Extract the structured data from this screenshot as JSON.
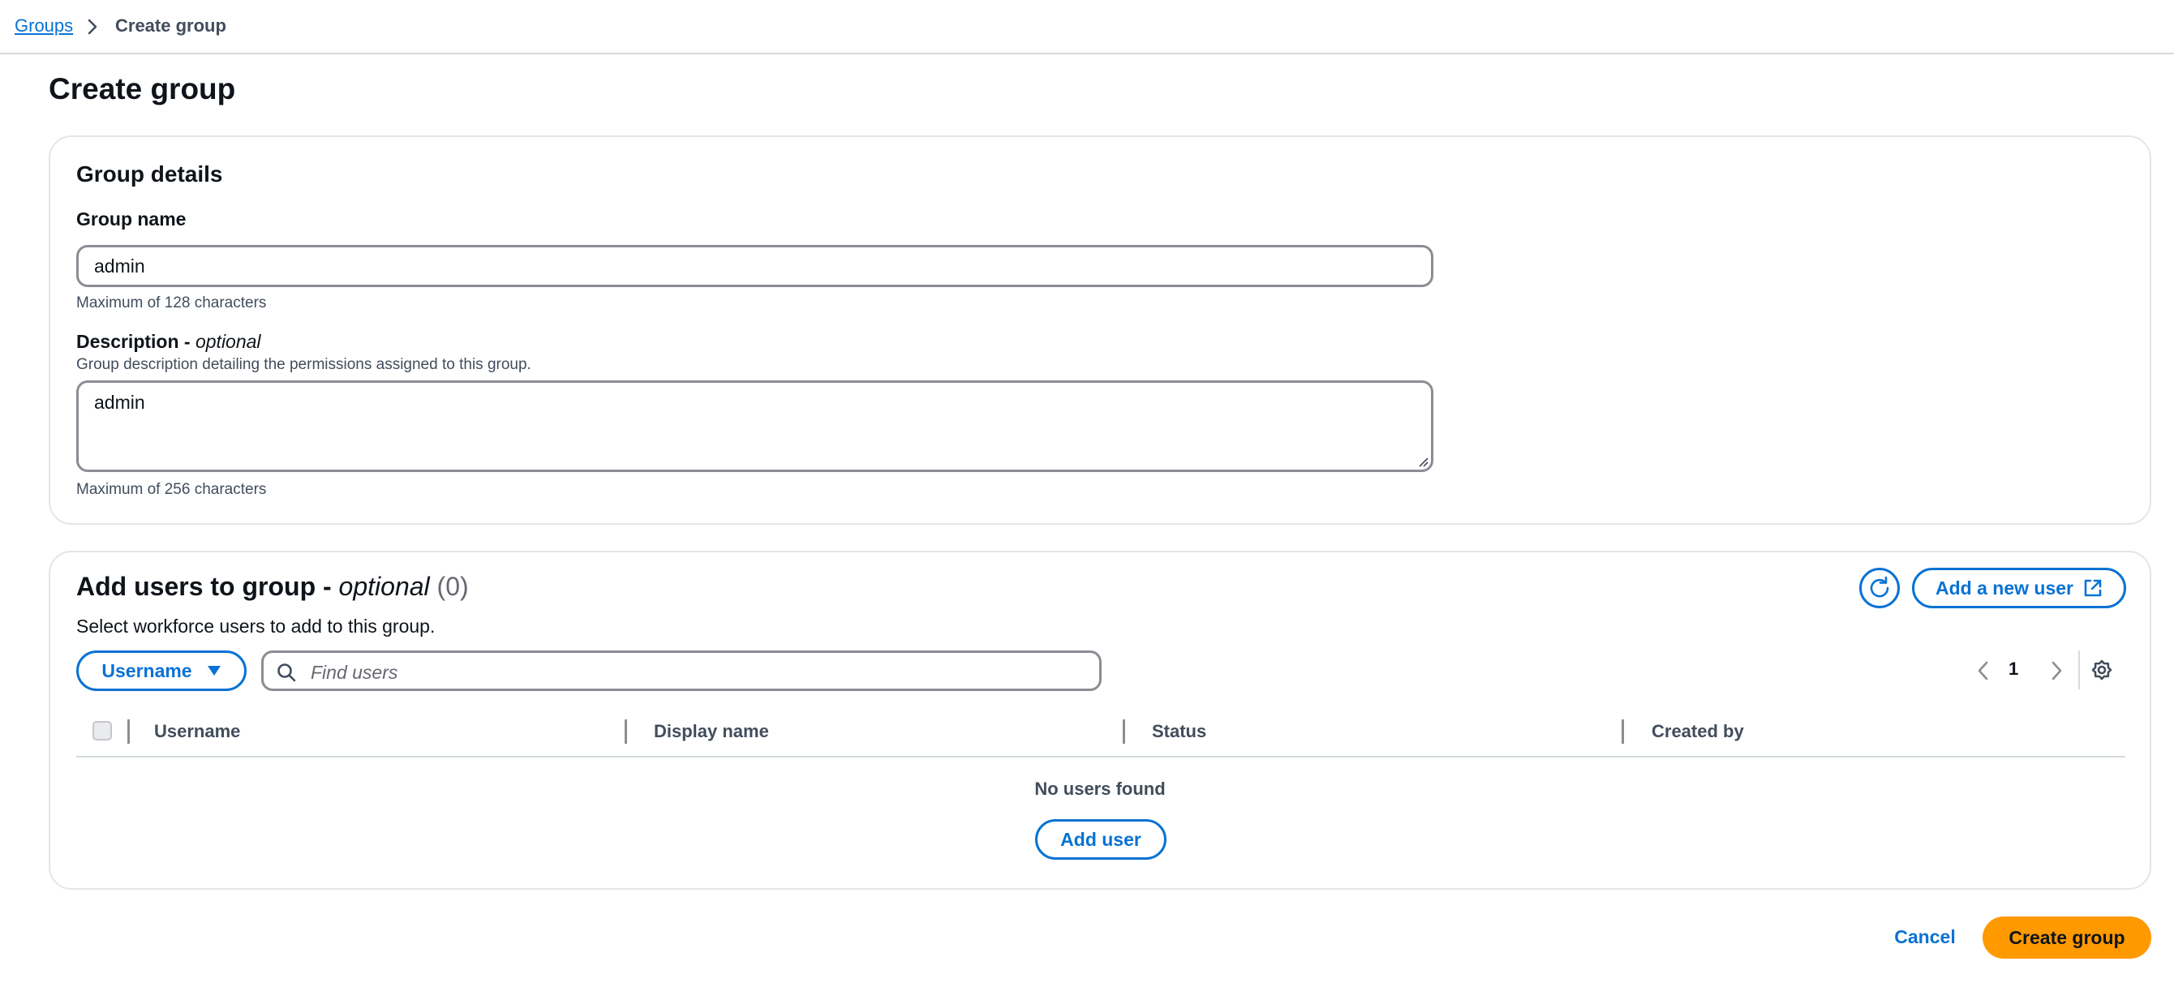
{
  "breadcrumb": {
    "parent": "Groups",
    "current": "Create group"
  },
  "page": {
    "title": "Create group"
  },
  "group_details": {
    "title": "Group details",
    "name_label": "Group name",
    "name_value": "admin",
    "name_hint": "Maximum of 128 characters",
    "description_label": "Description - ",
    "description_optional": "optional",
    "description_help": "Group description detailing the permissions assigned to this group.",
    "description_value": "admin",
    "description_hint": "Maximum of 256 characters"
  },
  "users": {
    "title": "Add users to group - ",
    "title_optional": "optional",
    "count": "(0)",
    "subtitle": "Select workforce users to add to this group.",
    "add_new_user_label": "Add a new user",
    "filter_property": "Username",
    "search_placeholder": "Find users",
    "current_page": "1",
    "columns": [
      "Username",
      "Display name",
      "Status",
      "Created by"
    ],
    "empty_text": "No users found",
    "add_user_label": "Add user"
  },
  "footer": {
    "cancel_label": "Cancel",
    "create_label": "Create group"
  },
  "icons": {
    "refresh": "refresh-icon",
    "external_link": "external-link-icon",
    "caret_down": "caret-down-icon",
    "search": "search-icon",
    "chevron_left": "chevron-left-icon",
    "chevron_right": "chevron-right-icon",
    "settings": "gear-icon"
  },
  "colors": {
    "link": "#0972d3",
    "primary_button": "#ff9900",
    "border": "#8c8c94"
  }
}
